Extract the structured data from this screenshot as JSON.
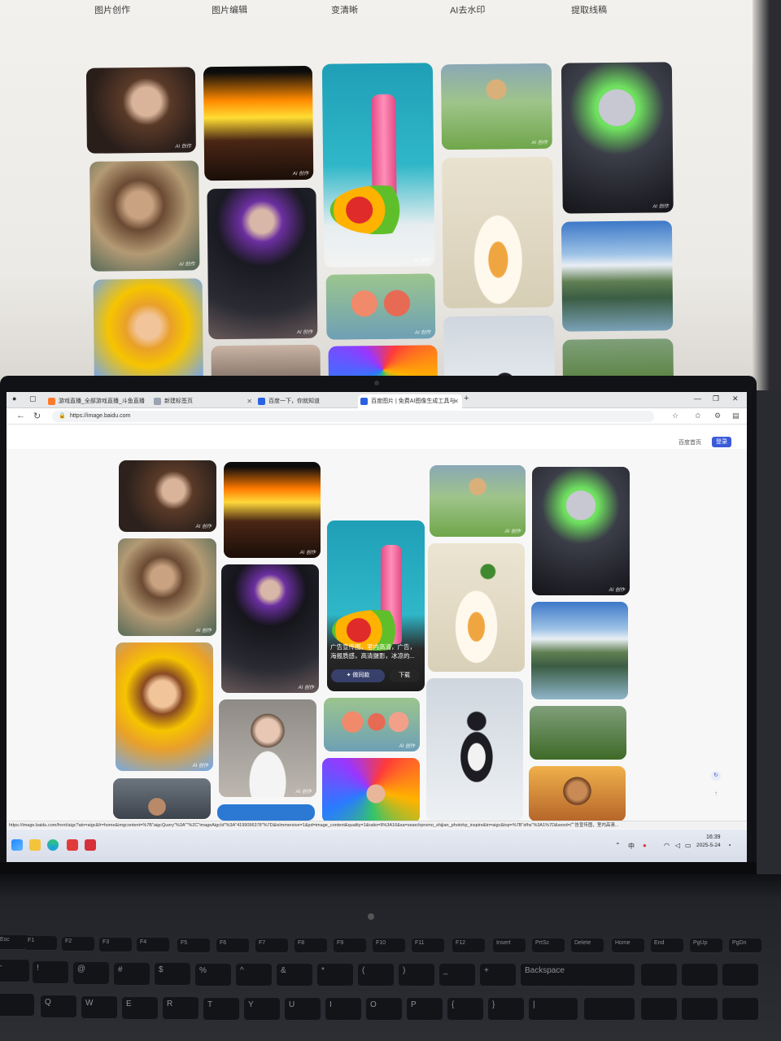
{
  "monitor": {
    "tabs": [
      "图片创作",
      "图片编辑",
      "变清晰",
      "AI去水印",
      "提取线稿"
    ]
  },
  "browser": {
    "tabs": [
      {
        "label": "游戏直播_全部游戏直播_斗鱼直播",
        "active": false
      },
      {
        "label": "新建标签页",
        "active": false
      },
      {
        "label": "百度一下，你就知道",
        "active": false
      },
      {
        "label": "百度图片 | 免费AI图像生成工具与",
        "active": true
      }
    ],
    "url": "https://image.baidu.com",
    "header": {
      "home_link": "百度首页",
      "login_button": "登录"
    },
    "hover_card": {
      "caption": "广告宣传图，室内高清，广告，海报质感，高清摄影，冰凉的...",
      "similar_button": "做同款",
      "download_button": "下载"
    },
    "ai_badge": "AI 创作",
    "status_url": "https://image.baidu.com/front/aigc?atn=aigc&fr=home&imgcontent=%7B\"aigcQuery\"%3A\"\"%2C\"imageAigcId\"%3A\"4199096378\"%7D&isImmersive=1&pd=image_content&quality=1&ratio=9%3A16&sa=searchpromo_shijian_photohp_inspire&tn=aigc&top=%7B\"sfhs\"%3A1%7D&word=广告宣传图，室内高清..."
  },
  "taskbar": {
    "ime_label": "中",
    "time": "16:39",
    "date": "2025-5-24"
  },
  "keyboard": {
    "function_row": [
      "Esc",
      "F1",
      "F2",
      "F3",
      "F4",
      "F5",
      "F6",
      "F7",
      "F8",
      "F9",
      "F10",
      "F11",
      "F12",
      "Insert",
      "PrtSc",
      "Delete",
      "Home",
      "End",
      "PgUp",
      "PgDn"
    ],
    "number_row": [
      "~",
      "!",
      "@",
      "#",
      "$",
      "%",
      "^",
      "&",
      "*",
      "(",
      ")",
      "_",
      "+",
      "Backspace"
    ],
    "letter_row": [
      "Q",
      "W",
      "E",
      "R",
      "T",
      "Y",
      "U",
      "I",
      "O",
      "P",
      "{",
      "}",
      "|"
    ]
  },
  "colors": {
    "accent": "#3a5bd9",
    "bezel": "#111216",
    "page_bg": "#f7f7f8",
    "taskbar": "#dfe3ee"
  },
  "icons": [
    "search-icon",
    "lock-icon",
    "back-icon",
    "refresh-icon",
    "star-icon",
    "close-icon",
    "windows-start-icon",
    "folder-icon",
    "edge-icon"
  ]
}
